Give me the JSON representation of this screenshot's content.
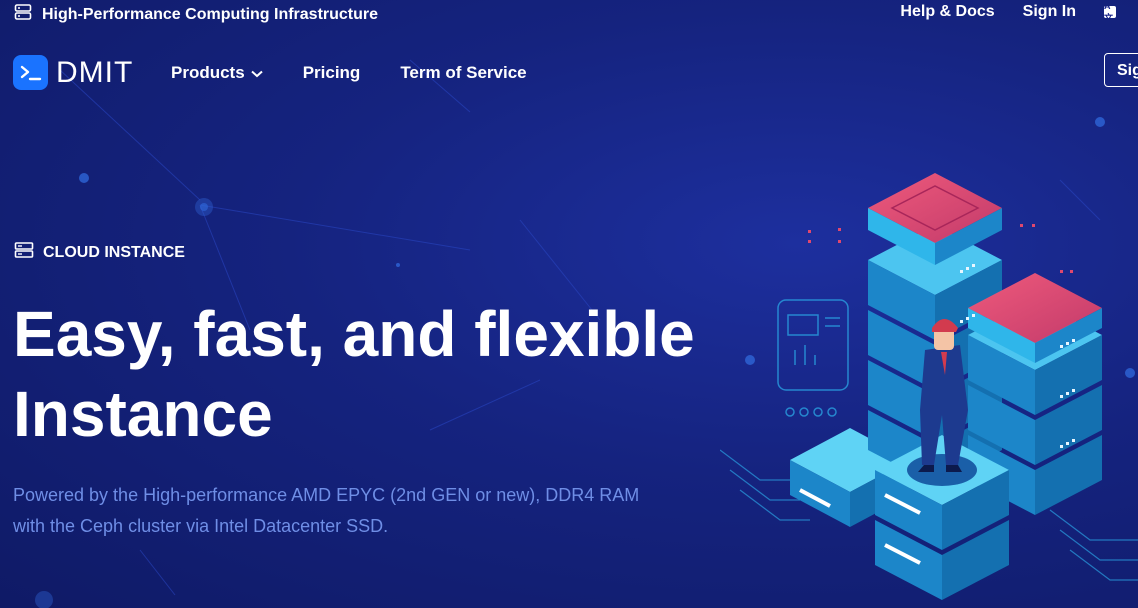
{
  "topbar": {
    "title": "High-Performance Computing Infrastructure",
    "help_label": "Help & Docs",
    "signin_label": "Sign In",
    "lang_glyphs": "A文"
  },
  "nav": {
    "logo_text": "DMIT",
    "items": [
      {
        "label": "Products",
        "has_dropdown": true
      },
      {
        "label": "Pricing"
      },
      {
        "label": "Term of Service"
      }
    ],
    "signup_label": "Sig"
  },
  "hero": {
    "eyebrow": "CLOUD INSTANCE",
    "headline_line1": "Easy, fast, and flexible",
    "headline_line2": "Instance",
    "description_line1": "Powered by the High-performance AMD EPYC (2nd GEN or new), DDR4 RAM",
    "description_line2": "with the Ceph cluster via Intel Datacenter SSD."
  },
  "colors": {
    "background": "#15237f",
    "accent": "#1a73ff",
    "server_cyan": "#2fb6ea",
    "server_pink": "#e0486e",
    "description_text": "#6f8ee6"
  },
  "icons": {
    "topbar": "server-icon",
    "logo": "terminal-icon",
    "eyebrow": "server-icon",
    "dropdown": "chevron-down-icon",
    "language": "translate-icon"
  }
}
